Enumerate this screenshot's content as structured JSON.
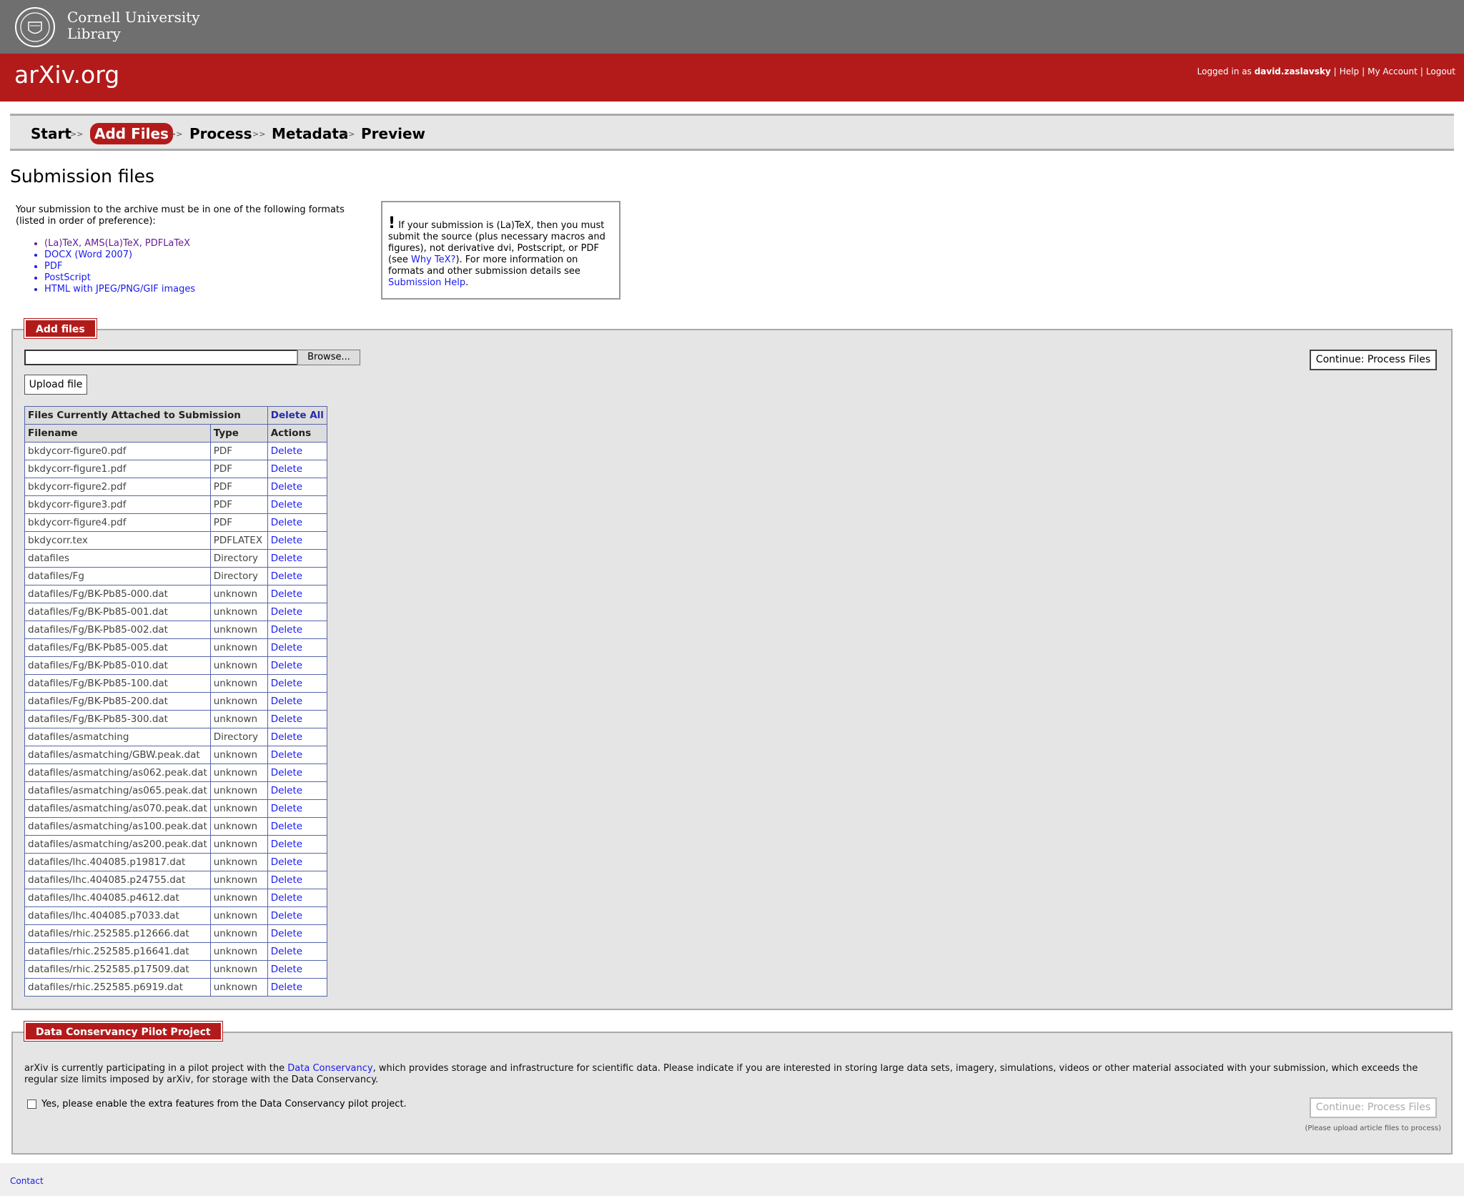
{
  "header": {
    "institution_line1": "Cornell University",
    "institution_line2": "Library",
    "site_logo": "arXiv.org",
    "logged_in_prefix": "Logged in as",
    "username": "david.zaslavsky",
    "help_link": "Help",
    "account_link": "My Account",
    "logout_link": "Logout"
  },
  "steps": {
    "start": "Start",
    "add_files": "Add Files",
    "process": "Process",
    "metadata": "Metadata",
    "preview": "Preview",
    "separator": ">>"
  },
  "page_title": "Submission files",
  "intro": {
    "text": "Your submission to the archive must be in one of the following formats (listed in order of preference):",
    "formats": [
      "(La)TeX, AMS(La)TeX, PDFLaTeX",
      "DOCX (Word 2007)",
      "PDF",
      "PostScript",
      "HTML with JPEG/PNG/GIF images"
    ]
  },
  "notice": {
    "bang": "!",
    "text1": "If your submission is (La)TeX, then you must submit the source (plus necessary macros and figures), not derivative dvi, Postscript, or PDF (see ",
    "why_link": "Why TeX?",
    "text2": "). For more information on formats and other submission details see ",
    "help_link": "Submission Help",
    "text3": "."
  },
  "add_files": {
    "legend": "Add files",
    "browse_label": "Browse...",
    "upload_label": "Upload file",
    "continue_label": "Continue: Process Files"
  },
  "files_table": {
    "caption": "Files Currently Attached to Submission",
    "delete_all": "Delete All",
    "headers": [
      "Filename",
      "Type",
      "Actions"
    ],
    "action_label": "Delete",
    "rows": [
      {
        "name": "bkdycorr-figure0.pdf",
        "type": "PDF"
      },
      {
        "name": "bkdycorr-figure1.pdf",
        "type": "PDF"
      },
      {
        "name": "bkdycorr-figure2.pdf",
        "type": "PDF"
      },
      {
        "name": "bkdycorr-figure3.pdf",
        "type": "PDF"
      },
      {
        "name": "bkdycorr-figure4.pdf",
        "type": "PDF"
      },
      {
        "name": "bkdycorr.tex",
        "type": "PDFLATEX"
      },
      {
        "name": "datafiles",
        "type": "Directory"
      },
      {
        "name": "datafiles/Fg",
        "type": "Directory"
      },
      {
        "name": "datafiles/Fg/BK-Pb85-000.dat",
        "type": "unknown"
      },
      {
        "name": "datafiles/Fg/BK-Pb85-001.dat",
        "type": "unknown"
      },
      {
        "name": "datafiles/Fg/BK-Pb85-002.dat",
        "type": "unknown"
      },
      {
        "name": "datafiles/Fg/BK-Pb85-005.dat",
        "type": "unknown"
      },
      {
        "name": "datafiles/Fg/BK-Pb85-010.dat",
        "type": "unknown"
      },
      {
        "name": "datafiles/Fg/BK-Pb85-100.dat",
        "type": "unknown"
      },
      {
        "name": "datafiles/Fg/BK-Pb85-200.dat",
        "type": "unknown"
      },
      {
        "name": "datafiles/Fg/BK-Pb85-300.dat",
        "type": "unknown"
      },
      {
        "name": "datafiles/asmatching",
        "type": "Directory"
      },
      {
        "name": "datafiles/asmatching/GBW.peak.dat",
        "type": "unknown"
      },
      {
        "name": "datafiles/asmatching/as062.peak.dat",
        "type": "unknown"
      },
      {
        "name": "datafiles/asmatching/as065.peak.dat",
        "type": "unknown"
      },
      {
        "name": "datafiles/asmatching/as070.peak.dat",
        "type": "unknown"
      },
      {
        "name": "datafiles/asmatching/as100.peak.dat",
        "type": "unknown"
      },
      {
        "name": "datafiles/asmatching/as200.peak.dat",
        "type": "unknown"
      },
      {
        "name": "datafiles/lhc.404085.p19817.dat",
        "type": "unknown"
      },
      {
        "name": "datafiles/lhc.404085.p24755.dat",
        "type": "unknown"
      },
      {
        "name": "datafiles/lhc.404085.p4612.dat",
        "type": "unknown"
      },
      {
        "name": "datafiles/lhc.404085.p7033.dat",
        "type": "unknown"
      },
      {
        "name": "datafiles/rhic.252585.p12666.dat",
        "type": "unknown"
      },
      {
        "name": "datafiles/rhic.252585.p16641.dat",
        "type": "unknown"
      },
      {
        "name": "datafiles/rhic.252585.p17509.dat",
        "type": "unknown"
      },
      {
        "name": "datafiles/rhic.252585.p6919.dat",
        "type": "unknown"
      }
    ]
  },
  "data_conservancy": {
    "legend": "Data Conservancy Pilot Project",
    "text1": "arXiv is currently participating in a pilot project with the ",
    "link": "Data Conservancy",
    "text2": ", which provides storage and infrastructure for scientific data. Please indicate if you are interested in storing large data sets, imagery, simulations, videos or other material associated with your submission, which exceeds the regular size limits imposed by arXiv, for storage with the Data Conservancy.",
    "checkbox_label": "Yes, please enable the extra features from the Data Conservancy pilot project.",
    "continue_label": "Continue: Process Files",
    "note": "(Please upload article files to process)"
  },
  "footer": {
    "contact": "Contact"
  },
  "colors": {
    "arxiv_red": "#b31b1b",
    "cornell_gray": "#6f6f6f",
    "link_blue": "#1a1aee",
    "panel_gray": "#e5e5e5"
  }
}
